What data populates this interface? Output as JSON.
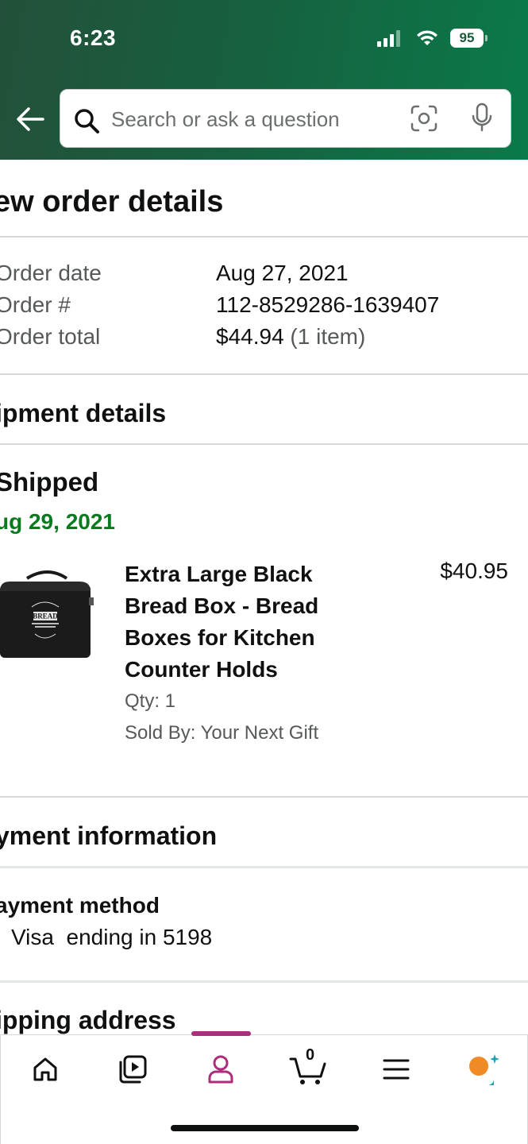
{
  "status_bar": {
    "time": "6:23",
    "battery": "95"
  },
  "search": {
    "placeholder": "Search or ask a question"
  },
  "page": {
    "title": "ew order details"
  },
  "order": {
    "rows": [
      {
        "label": "Order date",
        "value": "Aug 27, 2021"
      },
      {
        "label": "Order #",
        "value": "112-8529286-1639407"
      },
      {
        "label": "Order total",
        "value": "$44.94",
        "value_note": "(1 item)"
      }
    ]
  },
  "shipment": {
    "section_title": "ipment details",
    "status": "Shipped",
    "date": "ug 29, 2021",
    "product": {
      "image_alt": "black bread box",
      "title": "Extra Large Black Bread Box - Bread Boxes for Kitchen Counter Holds",
      "price": "$40.95",
      "qty": "Qty: 1",
      "seller": "Sold By: Your Next Gift"
    }
  },
  "payment": {
    "section_title": "yment information",
    "method_label": "ayment method",
    "method_value": "Visa  ending in 5198"
  },
  "shipping": {
    "section_title": "ipping address"
  },
  "bottom_nav": {
    "items": [
      {
        "name": "home",
        "icon": "home-icon"
      },
      {
        "name": "video",
        "icon": "play-icon"
      },
      {
        "name": "account",
        "icon": "person-icon"
      },
      {
        "name": "cart",
        "icon": "cart-icon",
        "count": "0"
      },
      {
        "name": "menu",
        "icon": "menu-icon"
      },
      {
        "name": "rufus",
        "icon": "assistant-icon"
      }
    ],
    "active": "account"
  },
  "colors": {
    "header_gradient_start": "#23503a",
    "header_gradient_end": "#0a7a4a",
    "ship_date": "#0a7a1e",
    "active_accent": "#ad2d7c",
    "assistant_orange": "#f08a24",
    "assistant_teal": "#1aa3b8"
  }
}
